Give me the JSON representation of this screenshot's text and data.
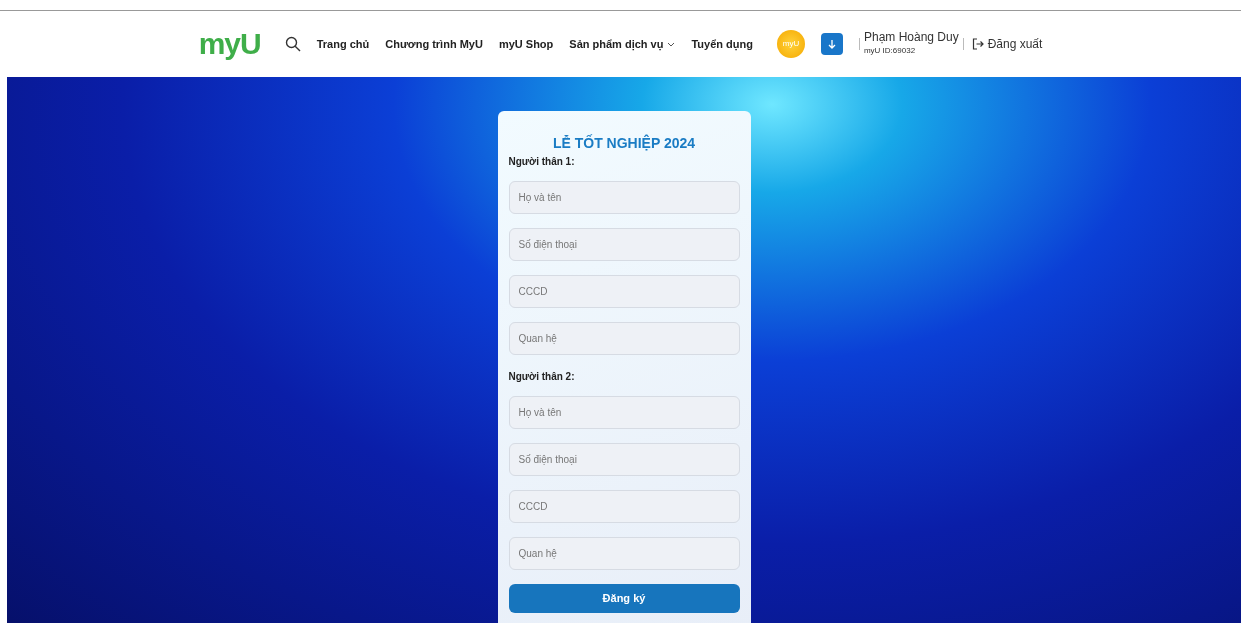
{
  "header": {
    "logo": "myU",
    "nav": [
      {
        "label": "Trang chủ",
        "dropdown": false
      },
      {
        "label": "Chương trình MyU",
        "dropdown": false
      },
      {
        "label": "myU Shop",
        "dropdown": false
      },
      {
        "label": "Sản phẩm dịch vụ",
        "dropdown": true
      },
      {
        "label": "Tuyển dụng",
        "dropdown": false
      }
    ],
    "coin": "myU",
    "user": {
      "name": "Phạm Hoàng Duy",
      "id": "myU ID:69032"
    },
    "logout": "Đăng xuất"
  },
  "form": {
    "title": "LỄ TỐT NGHIỆP 2024",
    "groups": [
      {
        "label": "Người thân 1:",
        "fields": [
          {
            "placeholder": "Họ và tên"
          },
          {
            "placeholder": "Số điện thoại"
          },
          {
            "placeholder": "CCCD"
          },
          {
            "placeholder": "Quan hệ"
          }
        ]
      },
      {
        "label": "Người thân 2:",
        "fields": [
          {
            "placeholder": "Họ và tên"
          },
          {
            "placeholder": "Số điện thoại"
          },
          {
            "placeholder": "CCCD"
          },
          {
            "placeholder": "Quan hệ"
          }
        ]
      }
    ],
    "submit": "Đăng ký"
  }
}
